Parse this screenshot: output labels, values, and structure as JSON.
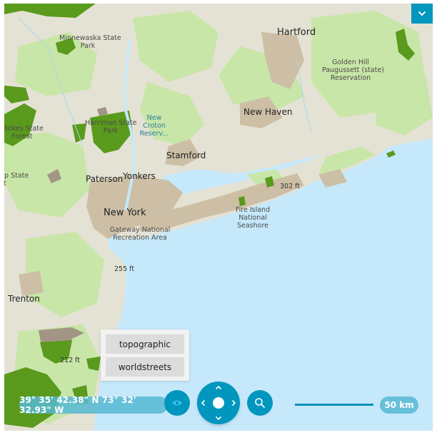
{
  "map": {
    "labels": {
      "hartford": "Hartford",
      "minnewaska": "Minnewaska State Park",
      "minnewaska_l1": "Minnewaska State",
      "minnewaska_l2": "Park",
      "golden_hill_l1": "Golden Hill",
      "golden_hill_l2": "Paugussett (state)",
      "golden_hill_l3": "Reservation",
      "stokes_l1": "Stokes State",
      "stokes_l2": "Forest",
      "harriman_l1": "Harriman State",
      "harriman_l2": "Park",
      "new_croton_l1": "New",
      "new_croton_l2": "Croton",
      "new_croton_l3": "Reserv...",
      "new_haven": "New Haven",
      "stamford": "Stamford",
      "swartswood_l1": "pp State",
      "swartswood_l2": "st",
      "paterson": "Paterson",
      "yonkers": "Yonkers",
      "elev_302": "302 ft",
      "new_york": "New York",
      "fire_island_l1": "Fire Island",
      "fire_island_l2": "National",
      "fire_island_l3": "Seashore",
      "gateway_l1": "Gateway National",
      "gateway_l2": "Recreation Area",
      "elev_255": "255 ft",
      "trenton": "Trenton",
      "elev_212": "212 ft"
    },
    "colors": {
      "water": "#c6e8fb",
      "land": "#e4e2d4",
      "vegetation": "#c8e6a8",
      "forest": "#5a9a1c",
      "urban": "#cdbfa5",
      "urban_dark": "#a39585",
      "accent": "#0096be"
    }
  },
  "controls": {
    "menu_toggle_icon": "chevron-down-icon",
    "basemaps": [
      {
        "label": "topographic"
      },
      {
        "label": "worldstreets"
      }
    ],
    "coordinates": "39° 35' 42.38\" N 73° 32' 32.93\" W",
    "eye_icon": "eye-icon",
    "search_icon": "search-icon",
    "scale_label": "50 km"
  }
}
